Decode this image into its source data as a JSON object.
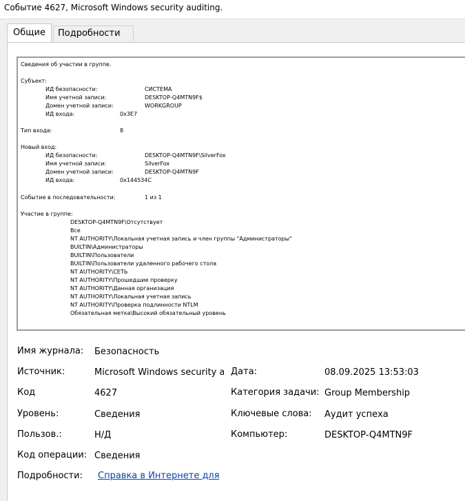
{
  "window": {
    "title": "Событие 4627, Microsoft Windows security auditing."
  },
  "tabs": [
    {
      "label": "Общие",
      "active": true
    },
    {
      "label": "Подробности",
      "active": false
    }
  ],
  "description": {
    "heading": "Сведения об участии в группе.",
    "subject_label": "Субъект:",
    "subject": {
      "sid_label": "ИД безопасности:",
      "sid_value": "СИСТЕМА",
      "account_label": "Имя учетной записи:",
      "account_value": "DESKTOP-Q4MTN9F$",
      "domain_label": "Домен учетной записи:",
      "domain_value": "WORKGROUP",
      "logon_id_label": "ИД входа:",
      "logon_id_value": "0x3E7"
    },
    "logon_type_label": "Тип входа:",
    "logon_type_value": "8",
    "new_logon_label": "Новый вход:",
    "new_logon": {
      "sid_label": "ИД безопасности:",
      "sid_value": "DESKTOP-Q4MTN9F\\SilverFox",
      "account_label": "Имя учетной записи:",
      "account_value": "SilverFox",
      "domain_label": "Домен учетной записи:",
      "domain_value": "DESKTOP-Q4MTN9F",
      "logon_id_label": "ИД входа:",
      "logon_id_value": "0x144534C"
    },
    "sequence_label": "Событие в последовательности:",
    "sequence_value": "1 из 1",
    "membership_label": "Участие в группе:",
    "groups": [
      "DESKTOP-Q4MTN9F\\Отсутствует",
      "Все",
      "NT AUTHORITY\\Локальная учетная запись и член группы \"Администраторы\"",
      "BUILTIN\\Администраторы",
      "BUILTIN\\Пользователи",
      "BUILTIN\\Пользователи удаленного рабочего стола",
      "NT AUTHORITY\\СЕТЬ",
      "NT AUTHORITY\\Прошедшие проверку",
      "NT AUTHORITY\\Данная организация",
      "NT AUTHORITY\\Локальная учетная запись",
      "NT AUTHORITY\\Проверка подлинности NTLM",
      "Обязательная метка\\Высокий обязательный уровень"
    ]
  },
  "details": {
    "log_name_label": "Имя журнала:",
    "log_name_value": "Безопасность",
    "source_label": "Источник:",
    "source_value": "Microsoft Windows security auditing.",
    "date_label": "Дата:",
    "date_value": "08.09.2025 13:53:03",
    "code_label": "Код",
    "code_value": "4627",
    "task_category_label": "Категория задачи:",
    "task_category_value": "Group Membership",
    "level_label": "Уровень:",
    "level_value": "Сведения",
    "keywords_label": "Ключевые слова:",
    "keywords_value": "Аудит успеха",
    "user_label": "Пользов.:",
    "user_value": "Н/Д",
    "computer_label": "Компьютер:",
    "computer_value": "DESKTOP-Q4MTN9F",
    "opcode_label": "Код операции:",
    "opcode_value": "Сведения",
    "more_info_label": "Подробности:",
    "more_info_link": "Справка в Интернете для журнала"
  }
}
